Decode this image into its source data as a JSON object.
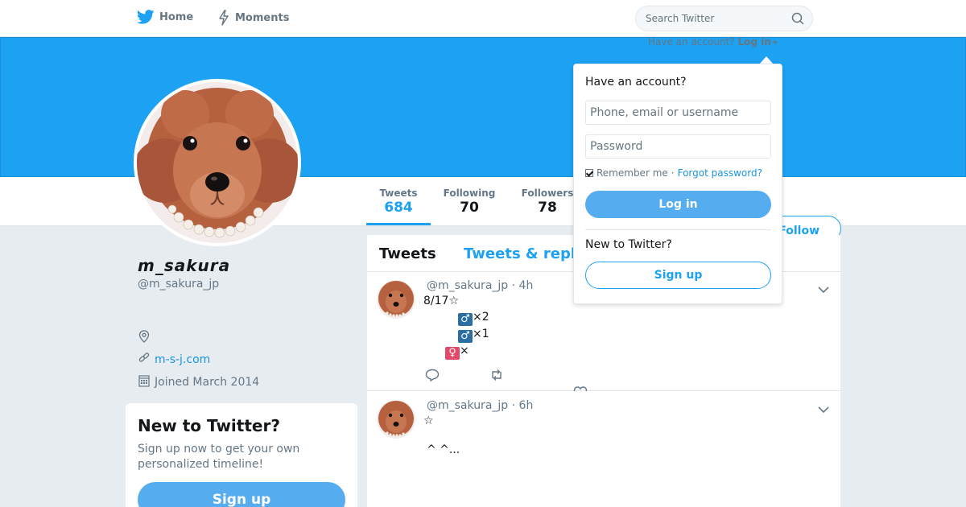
{
  "nav": {
    "home_label": "Home",
    "moments_label": "Moments",
    "search_placeholder": "Search Twitter"
  },
  "account_prompt": {
    "text": "Have an account?",
    "login_label": "Log in"
  },
  "profile": {
    "name": "𝙢_𝙨𝙖𝙠𝙪𝙧𝙖",
    "handle": "@m_sakura_jp",
    "location": "",
    "url": "m-s-j.com",
    "joined": "Joined March 2014"
  },
  "stats": [
    {
      "label": "Tweets",
      "value": "684"
    },
    {
      "label": "Following",
      "value": "70"
    },
    {
      "label": "Followers",
      "value": "78"
    }
  ],
  "follow_label": "Follow",
  "timeline": {
    "tab_tweets": "Tweets",
    "tab_replies": "Tweets & repl",
    "tweets": [
      {
        "handle": "@m_sakura_jp",
        "time": "4h",
        "lines": {
          "l1": "8/17☆",
          "l2_emoji": "♂",
          "l2_text": "×2",
          "l3_emoji": "♂",
          "l3_text": "×1",
          "l4_emoji": "♀",
          "l4_text": "×"
        }
      },
      {
        "handle": "@m_sakura_jp",
        "time": "6h",
        "lines": {
          "l1": "☆",
          "l2": "^ ^..."
        }
      }
    ]
  },
  "new_card": {
    "title": "New to Twitter?",
    "subtitle": "Sign up now to get your own personalized timeline!",
    "button": "Sign up"
  },
  "login_dropdown": {
    "title": "Have an account?",
    "username_placeholder": "Phone, email or username",
    "password_placeholder": "Password",
    "remember_label": "Remember me",
    "separator": "·",
    "forgot_label": "Forgot password?",
    "login_button": "Log in",
    "new_prompt": "New to Twitter?",
    "signup_button": "Sign up"
  },
  "colors": {
    "brand": "#1da1f2",
    "button_fill": "#55acee",
    "background": "#e6ecf0"
  }
}
